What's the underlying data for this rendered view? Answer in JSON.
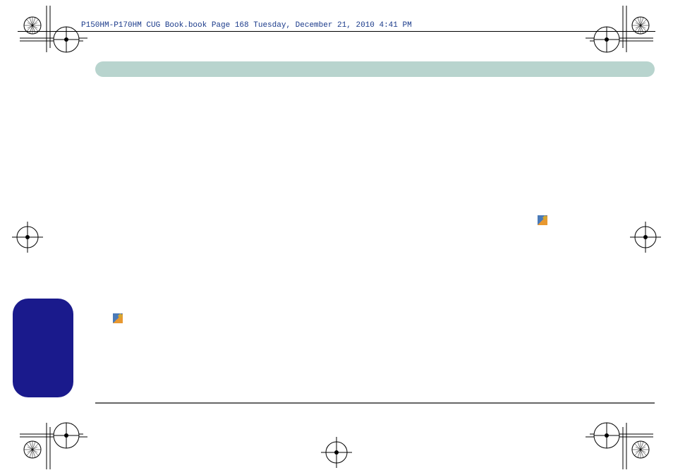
{
  "header": {
    "text": "P150HM-P170HM CUG Book.book  Page 168  Tuesday, December 21, 2010  4:41 PM"
  }
}
